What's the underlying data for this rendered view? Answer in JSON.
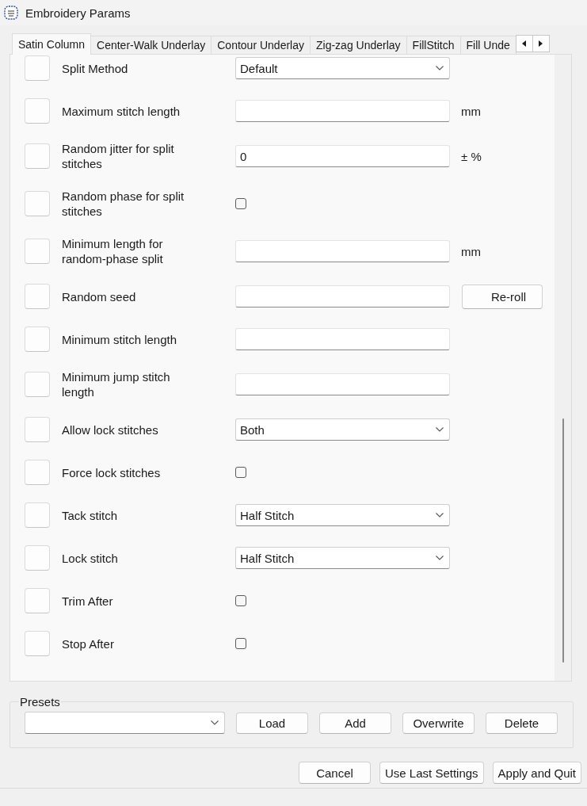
{
  "window": {
    "title": "Embroidery Params"
  },
  "tabs": [
    {
      "label": "Satin Column",
      "selected": true
    },
    {
      "label": "Center-Walk Underlay",
      "selected": false
    },
    {
      "label": "Contour Underlay",
      "selected": false
    },
    {
      "label": "Zig-zag Underlay",
      "selected": false
    },
    {
      "label": "FillStitch",
      "selected": false
    },
    {
      "label": "Fill Unde",
      "selected": false
    }
  ],
  "params": [
    {
      "kind": "dropdown",
      "label": "Split Method",
      "value": "Default"
    },
    {
      "kind": "text",
      "label": "Maximum stitch length",
      "unit": "mm"
    },
    {
      "kind": "text",
      "label": "Random jitter for split stitches",
      "value": "0",
      "unit": "± %"
    },
    {
      "kind": "checkbox",
      "label": "Random phase for split stitches",
      "checked": false
    },
    {
      "kind": "text",
      "label": "Minimum length for random-phase split",
      "unit": "mm"
    },
    {
      "kind": "text",
      "label": "Random seed",
      "button": "Re-roll"
    },
    {
      "kind": "text",
      "label": "Minimum stitch length"
    },
    {
      "kind": "text",
      "label": "Minimum jump stitch length"
    },
    {
      "kind": "dropdown",
      "label": "Allow lock stitches",
      "value": "Both"
    },
    {
      "kind": "checkbox",
      "label": "Force lock stitches",
      "checked": false
    },
    {
      "kind": "dropdown",
      "label": "Tack stitch",
      "value": "Half Stitch"
    },
    {
      "kind": "dropdown",
      "label": "Lock stitch",
      "value": "Half Stitch"
    },
    {
      "kind": "checkbox",
      "label": "Trim After",
      "checked": false
    },
    {
      "kind": "checkbox",
      "label": "Stop After",
      "checked": false
    }
  ],
  "presets": {
    "title": "Presets",
    "buttons": [
      "Load",
      "Add",
      "Overwrite",
      "Delete"
    ]
  },
  "buttons": [
    "Cancel",
    "Use Last Settings",
    "Apply and Quit"
  ]
}
